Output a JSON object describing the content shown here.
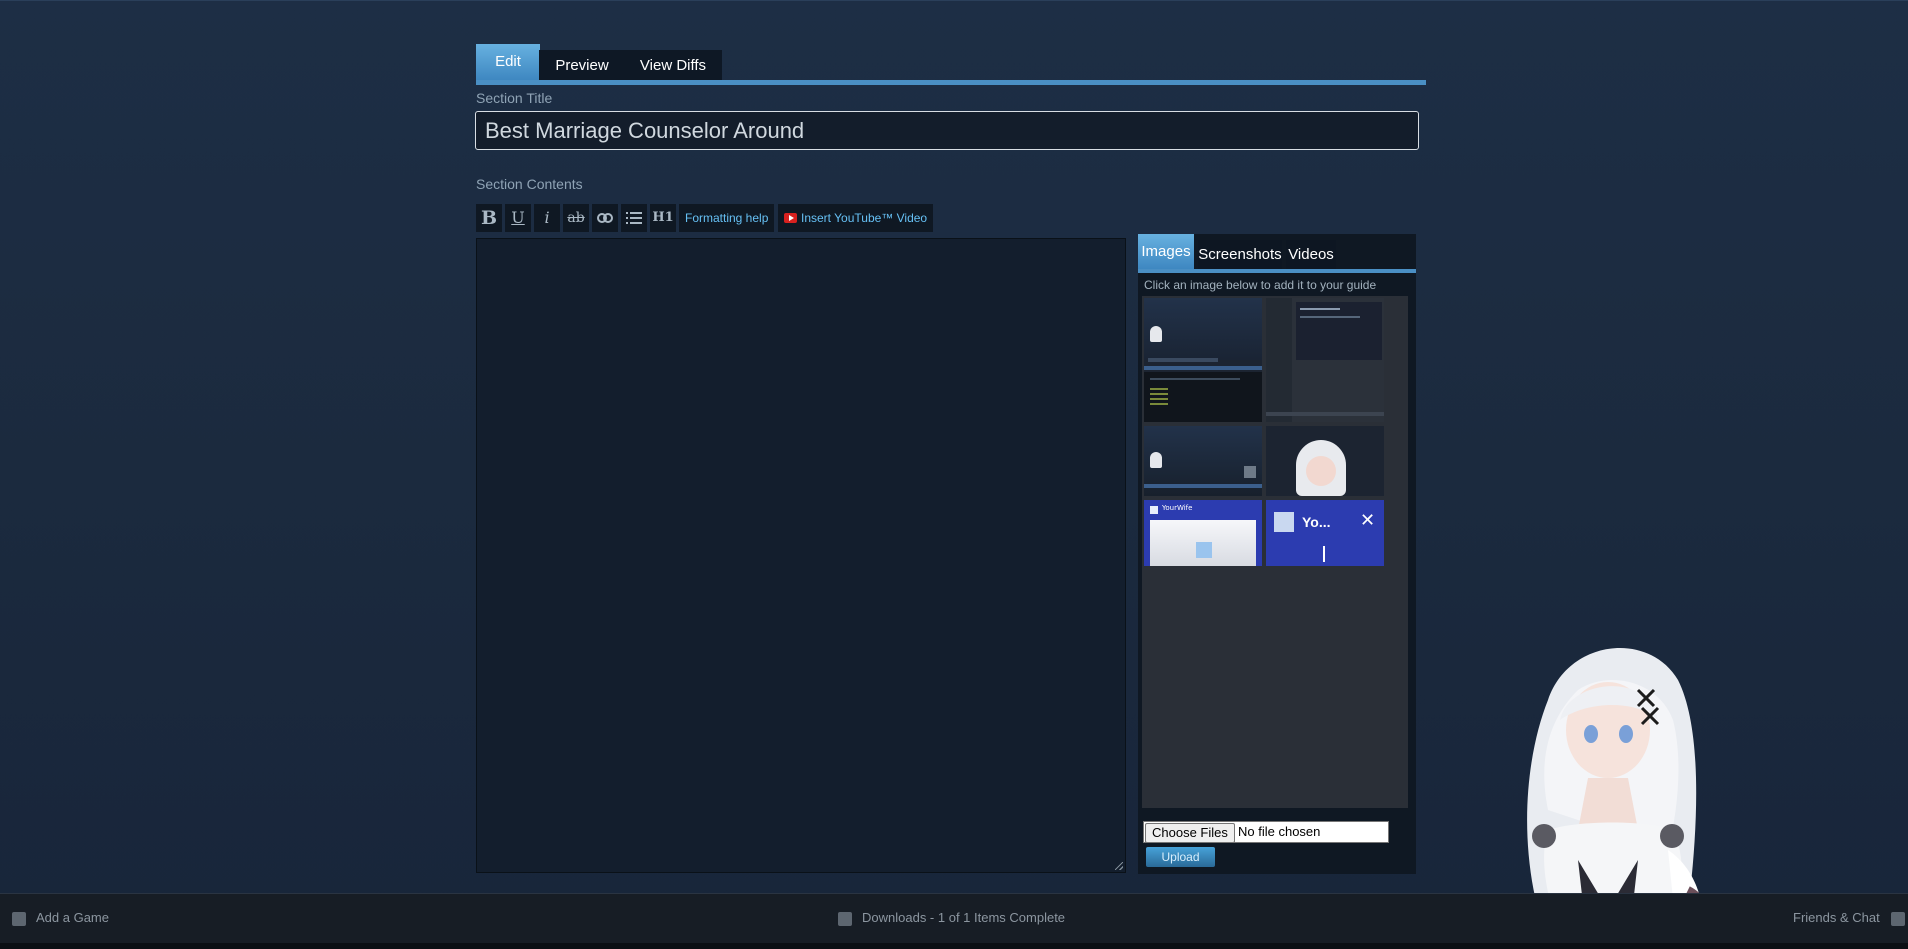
{
  "tabs": {
    "edit": "Edit",
    "preview": "Preview",
    "view_diffs": "View Diffs"
  },
  "section_title": {
    "label": "Section Title",
    "value": "Best Marriage Counselor Around"
  },
  "section_contents": {
    "label": "Section Contents"
  },
  "toolbar": {
    "bold": "B",
    "underline": "U",
    "italic": "i",
    "strike": "ab",
    "h1": "H1",
    "formatting_help": "Formatting help",
    "insert_youtube": "Insert YouTube™ Video"
  },
  "media": {
    "tabs": [
      "Images",
      "Screenshots",
      "Videos"
    ],
    "hint": "Click an image below to add it to your guide",
    "thumb_text_1": "YourWife",
    "thumb_text_2": "Yo...",
    "choose_files": "Choose Files",
    "no_file": "No file chosen",
    "upload": "Upload"
  },
  "bottombar": {
    "add_game": "Add a Game",
    "downloads": "Downloads - 1 of 1 Items Complete",
    "friends_chat": "Friends & Chat"
  },
  "colors": {
    "accent": "#4a8fc4",
    "link": "#66c0f4",
    "bg": "#1b2a3e"
  }
}
